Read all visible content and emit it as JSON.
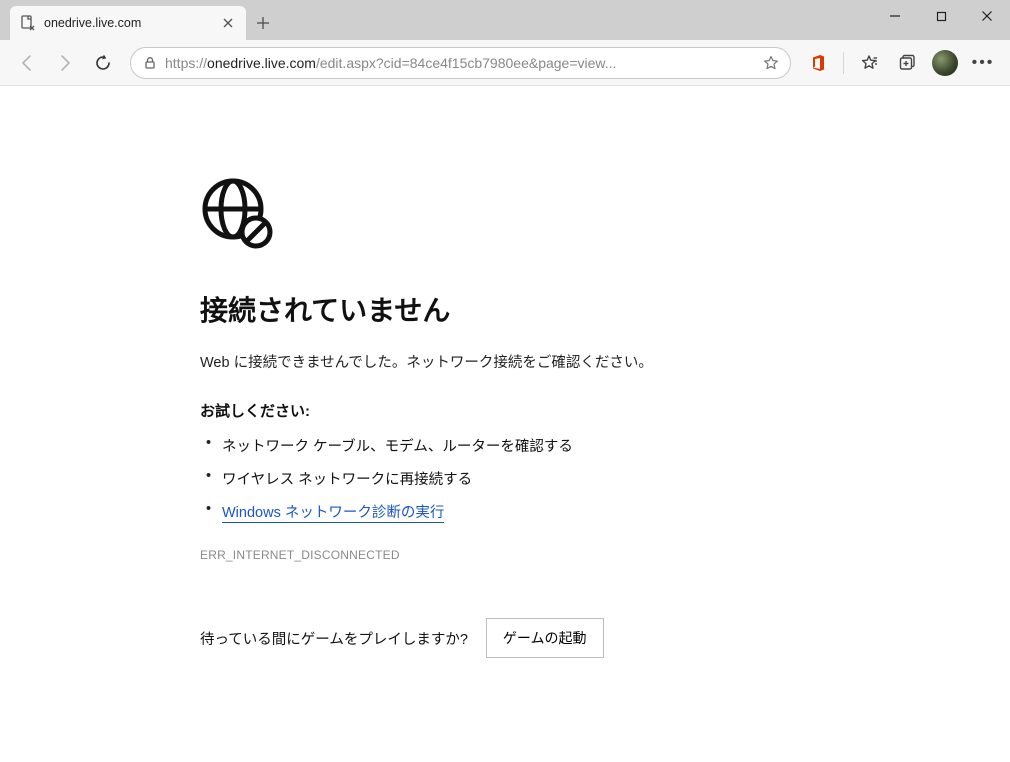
{
  "tab": {
    "title": "onedrive.live.com"
  },
  "address": {
    "scheme": "https://",
    "domain": "onedrive.live.com",
    "path": "/edit.aspx?cid=84ce4f15cb7980ee&page=view..."
  },
  "error": {
    "heading": "接続されていません",
    "message": "Web に接続できませんでした。ネットワーク接続をご確認ください。",
    "try_title": "お試しください:",
    "suggestions": [
      "ネットワーク ケーブル、モデム、ルーターを確認する",
      "ワイヤレス ネットワークに再接続する"
    ],
    "diag_link": "Windows ネットワーク診断の実行",
    "code": "ERR_INTERNET_DISCONNECTED",
    "game_prompt": "待っている間にゲームをプレイしますか?",
    "game_button": "ゲームの起動"
  }
}
